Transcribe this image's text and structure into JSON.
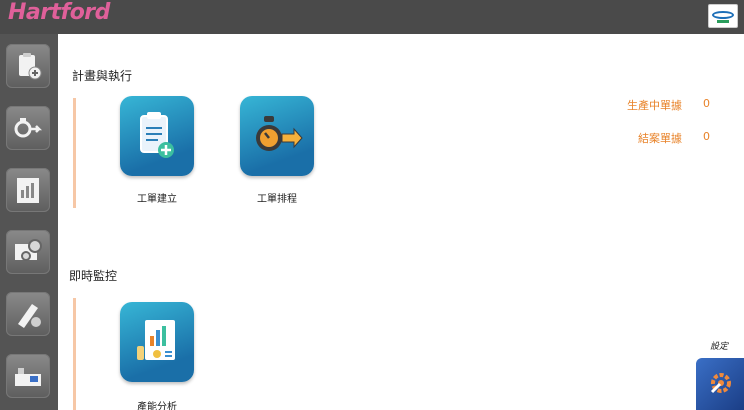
{
  "brand": {
    "name": "Hartford"
  },
  "sidebar": {
    "items": [
      {
        "icon": "clipboard-add-icon"
      },
      {
        "icon": "timer-arrow-icon"
      },
      {
        "icon": "report-icon"
      },
      {
        "icon": "machine-gear-icon"
      },
      {
        "icon": "tool-icon"
      },
      {
        "icon": "factory-icon"
      }
    ]
  },
  "sections": [
    {
      "title": "計畫與執行",
      "tiles": [
        {
          "label": "工單建立",
          "icon": "clipboard-add-icon"
        },
        {
          "label": "工單排程",
          "icon": "timer-arrow-icon"
        }
      ]
    },
    {
      "title": "即時監控",
      "tiles": [
        {
          "label": "產能分析",
          "icon": "analytics-report-icon"
        }
      ]
    }
  ],
  "stats": [
    {
      "label": "生產中單據",
      "value": "0"
    },
    {
      "label": "結案單據",
      "value": "0"
    }
  ],
  "settings": {
    "label": "設定",
    "icon": "gear-wrench-icon"
  },
  "colors": {
    "topbar": "#4a4a4a",
    "sidebar": "#545454",
    "brand": "#e0609a",
    "accent_orange": "#e8832a",
    "tile_blue": "#1a6fa8"
  }
}
